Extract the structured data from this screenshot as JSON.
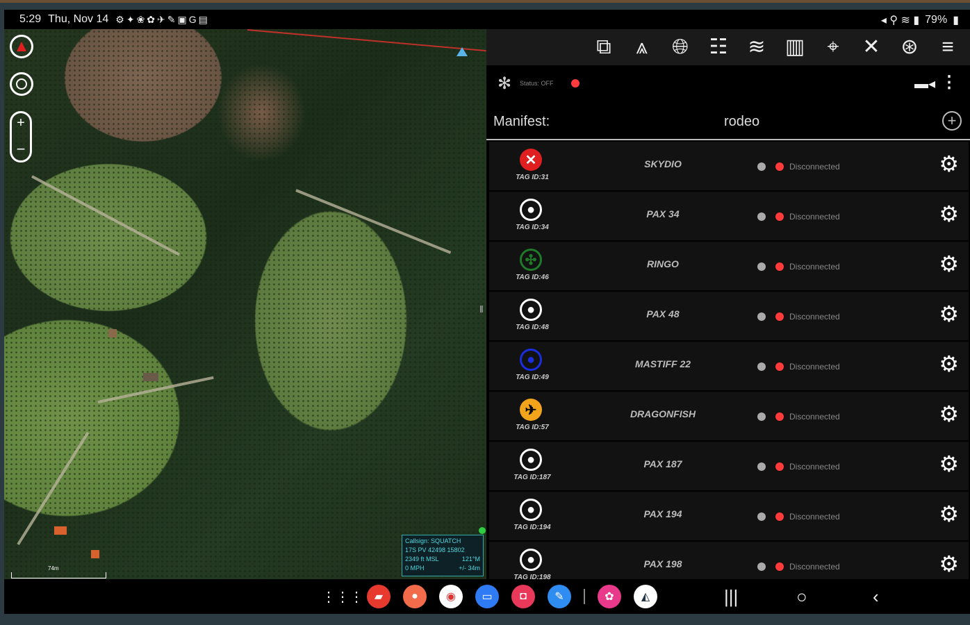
{
  "status_bar": {
    "time": "5:29",
    "date": "Thu, Nov 14",
    "left_icons": [
      "bug-icon",
      "people-icon",
      "leaf-icon",
      "settings-icon",
      "plane-icon",
      "wand-icon",
      "photo-icon",
      "google-icon",
      "file-icon"
    ],
    "battery": "79%"
  },
  "map": {
    "info": {
      "callsign": "Callsign: SQUATCH",
      "grid": "17S PV 42498 15802",
      "alt": "2349 ft MSL",
      "heading": "121°M",
      "speed": "0 MPH",
      "accuracy": "+/- 34m"
    },
    "scale_label": "74m"
  },
  "toolbar": {
    "buttons": [
      "window-icon",
      "elevation-icon",
      "globe-icon",
      "team-icon",
      "layers-icon",
      "map-icon",
      "pin-icon",
      "tools-icon",
      "network-icon",
      "menu-icon"
    ]
  },
  "panel": {
    "status_label": "Status: OFF",
    "manifest_label": "Manifest:",
    "manifest_value": "rodeo",
    "rows": [
      {
        "tag": "TAG ID:31",
        "name": "SKYDIO",
        "status": "Disconnected",
        "icon": "x-circle",
        "color": "#e02020"
      },
      {
        "tag": "TAG ID:34",
        "name": "PAX 34",
        "status": "Disconnected",
        "icon": "person",
        "color": "#ffffff"
      },
      {
        "tag": "TAG ID:46",
        "name": "RINGO",
        "status": "Disconnected",
        "icon": "drone",
        "color": "#1f7a2a"
      },
      {
        "tag": "TAG ID:48",
        "name": "PAX 48",
        "status": "Disconnected",
        "icon": "person",
        "color": "#ffffff"
      },
      {
        "tag": "TAG ID:49",
        "name": "MASTIFF 22",
        "status": "Disconnected",
        "icon": "person",
        "color": "#1a2ee0"
      },
      {
        "tag": "TAG ID:57",
        "name": "DRAGONFISH",
        "status": "Disconnected",
        "icon": "airplane",
        "color": "#f2a51a"
      },
      {
        "tag": "TAG ID:187",
        "name": "PAX 187",
        "status": "Disconnected",
        "icon": "person",
        "color": "#ffffff"
      },
      {
        "tag": "TAG ID:194",
        "name": "PAX 194",
        "status": "Disconnected",
        "icon": "person",
        "color": "#ffffff"
      },
      {
        "tag": "TAG ID:198",
        "name": "PAX 198",
        "status": "Disconnected",
        "icon": "person",
        "color": "#ffffff"
      }
    ]
  },
  "navbar": {
    "apps": [
      {
        "name": "app-drawer-icon",
        "color": "transparent"
      },
      {
        "name": "notes-app-icon",
        "color": "#e8392f"
      },
      {
        "name": "contacts-app-icon",
        "color": "#f26b4a"
      },
      {
        "name": "chrome-app-icon",
        "color": "#ffffff"
      },
      {
        "name": "messages-app-icon",
        "color": "#2f7bf6"
      },
      {
        "name": "camera-app-icon",
        "color": "#e8395a"
      },
      {
        "name": "pen-app-icon",
        "color": "#2f8cf0"
      },
      {
        "name": "flower-app-icon",
        "color": "#e8398a"
      },
      {
        "name": "atak-app-icon",
        "color": "#ffffff"
      }
    ]
  }
}
